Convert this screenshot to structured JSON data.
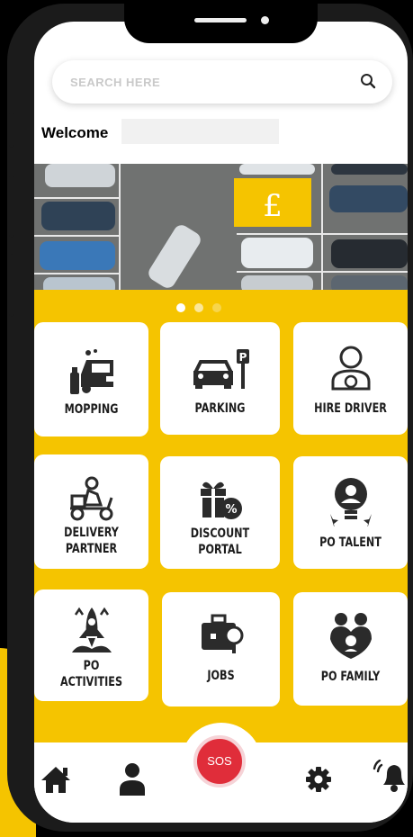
{
  "search": {
    "placeholder": "SEARCH HERE",
    "icon": "search-icon"
  },
  "welcome": {
    "label": "Welcome"
  },
  "banner": {
    "sign": "£",
    "slides_total": 3,
    "active_slide": 1
  },
  "services": [
    {
      "label": "MOPPING",
      "icon": "car-wash-icon"
    },
    {
      "label": "PARKING",
      "icon": "parking-icon"
    },
    {
      "label": "HIRE DRIVER",
      "icon": "driver-icon"
    },
    {
      "label1": "DELIVERY",
      "label2": "PARTNER",
      "icon": "delivery-scooter-icon"
    },
    {
      "label1": "DISCOUNT",
      "label2": "PORTAL",
      "icon": "discount-gift-icon"
    },
    {
      "label": "PO TALENT",
      "icon": "talent-bulb-icon"
    },
    {
      "label1": "PO",
      "label2": "ACTIVITIES",
      "icon": "rocket-icon"
    },
    {
      "label": "JOBS",
      "icon": "briefcase-icon"
    },
    {
      "label": "PO FAMILY",
      "icon": "family-icon"
    }
  ],
  "sos": {
    "label": "SOS"
  },
  "nav": [
    "home-icon",
    "profile-icon",
    "settings-icon",
    "notification-bell-icon"
  ],
  "colors": {
    "accent": "#f5c400",
    "sos": "#e02d3a",
    "background": "#000000"
  }
}
